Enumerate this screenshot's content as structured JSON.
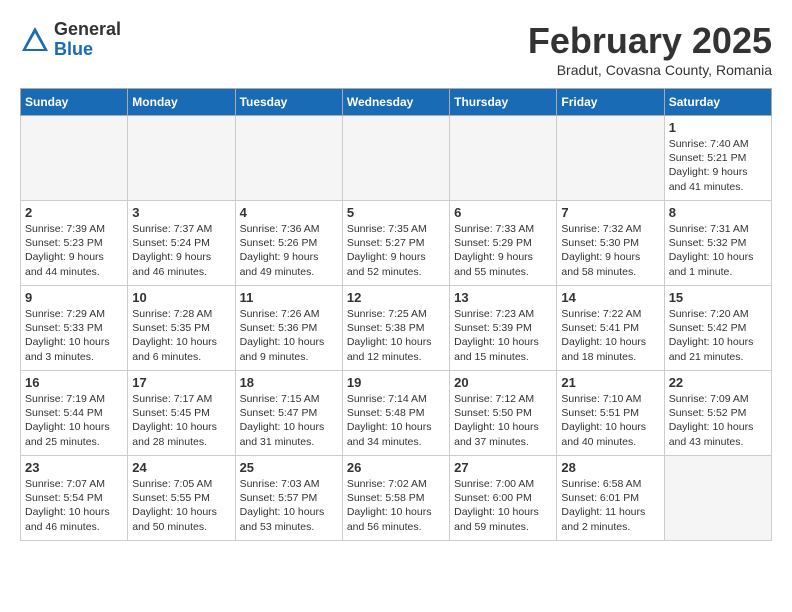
{
  "header": {
    "logo_general": "General",
    "logo_blue": "Blue",
    "month_title": "February 2025",
    "location": "Bradut, Covasna County, Romania"
  },
  "weekdays": [
    "Sunday",
    "Monday",
    "Tuesday",
    "Wednesday",
    "Thursday",
    "Friday",
    "Saturday"
  ],
  "weeks": [
    [
      {
        "day": "",
        "info": ""
      },
      {
        "day": "",
        "info": ""
      },
      {
        "day": "",
        "info": ""
      },
      {
        "day": "",
        "info": ""
      },
      {
        "day": "",
        "info": ""
      },
      {
        "day": "",
        "info": ""
      },
      {
        "day": "1",
        "info": "Sunrise: 7:40 AM\nSunset: 5:21 PM\nDaylight: 9 hours and 41 minutes."
      }
    ],
    [
      {
        "day": "2",
        "info": "Sunrise: 7:39 AM\nSunset: 5:23 PM\nDaylight: 9 hours and 44 minutes."
      },
      {
        "day": "3",
        "info": "Sunrise: 7:37 AM\nSunset: 5:24 PM\nDaylight: 9 hours and 46 minutes."
      },
      {
        "day": "4",
        "info": "Sunrise: 7:36 AM\nSunset: 5:26 PM\nDaylight: 9 hours and 49 minutes."
      },
      {
        "day": "5",
        "info": "Sunrise: 7:35 AM\nSunset: 5:27 PM\nDaylight: 9 hours and 52 minutes."
      },
      {
        "day": "6",
        "info": "Sunrise: 7:33 AM\nSunset: 5:29 PM\nDaylight: 9 hours and 55 minutes."
      },
      {
        "day": "7",
        "info": "Sunrise: 7:32 AM\nSunset: 5:30 PM\nDaylight: 9 hours and 58 minutes."
      },
      {
        "day": "8",
        "info": "Sunrise: 7:31 AM\nSunset: 5:32 PM\nDaylight: 10 hours and 1 minute."
      }
    ],
    [
      {
        "day": "9",
        "info": "Sunrise: 7:29 AM\nSunset: 5:33 PM\nDaylight: 10 hours and 3 minutes."
      },
      {
        "day": "10",
        "info": "Sunrise: 7:28 AM\nSunset: 5:35 PM\nDaylight: 10 hours and 6 minutes."
      },
      {
        "day": "11",
        "info": "Sunrise: 7:26 AM\nSunset: 5:36 PM\nDaylight: 10 hours and 9 minutes."
      },
      {
        "day": "12",
        "info": "Sunrise: 7:25 AM\nSunset: 5:38 PM\nDaylight: 10 hours and 12 minutes."
      },
      {
        "day": "13",
        "info": "Sunrise: 7:23 AM\nSunset: 5:39 PM\nDaylight: 10 hours and 15 minutes."
      },
      {
        "day": "14",
        "info": "Sunrise: 7:22 AM\nSunset: 5:41 PM\nDaylight: 10 hours and 18 minutes."
      },
      {
        "day": "15",
        "info": "Sunrise: 7:20 AM\nSunset: 5:42 PM\nDaylight: 10 hours and 21 minutes."
      }
    ],
    [
      {
        "day": "16",
        "info": "Sunrise: 7:19 AM\nSunset: 5:44 PM\nDaylight: 10 hours and 25 minutes."
      },
      {
        "day": "17",
        "info": "Sunrise: 7:17 AM\nSunset: 5:45 PM\nDaylight: 10 hours and 28 minutes."
      },
      {
        "day": "18",
        "info": "Sunrise: 7:15 AM\nSunset: 5:47 PM\nDaylight: 10 hours and 31 minutes."
      },
      {
        "day": "19",
        "info": "Sunrise: 7:14 AM\nSunset: 5:48 PM\nDaylight: 10 hours and 34 minutes."
      },
      {
        "day": "20",
        "info": "Sunrise: 7:12 AM\nSunset: 5:50 PM\nDaylight: 10 hours and 37 minutes."
      },
      {
        "day": "21",
        "info": "Sunrise: 7:10 AM\nSunset: 5:51 PM\nDaylight: 10 hours and 40 minutes."
      },
      {
        "day": "22",
        "info": "Sunrise: 7:09 AM\nSunset: 5:52 PM\nDaylight: 10 hours and 43 minutes."
      }
    ],
    [
      {
        "day": "23",
        "info": "Sunrise: 7:07 AM\nSunset: 5:54 PM\nDaylight: 10 hours and 46 minutes."
      },
      {
        "day": "24",
        "info": "Sunrise: 7:05 AM\nSunset: 5:55 PM\nDaylight: 10 hours and 50 minutes."
      },
      {
        "day": "25",
        "info": "Sunrise: 7:03 AM\nSunset: 5:57 PM\nDaylight: 10 hours and 53 minutes."
      },
      {
        "day": "26",
        "info": "Sunrise: 7:02 AM\nSunset: 5:58 PM\nDaylight: 10 hours and 56 minutes."
      },
      {
        "day": "27",
        "info": "Sunrise: 7:00 AM\nSunset: 6:00 PM\nDaylight: 10 hours and 59 minutes."
      },
      {
        "day": "28",
        "info": "Sunrise: 6:58 AM\nSunset: 6:01 PM\nDaylight: 11 hours and 2 minutes."
      },
      {
        "day": "",
        "info": ""
      }
    ]
  ]
}
